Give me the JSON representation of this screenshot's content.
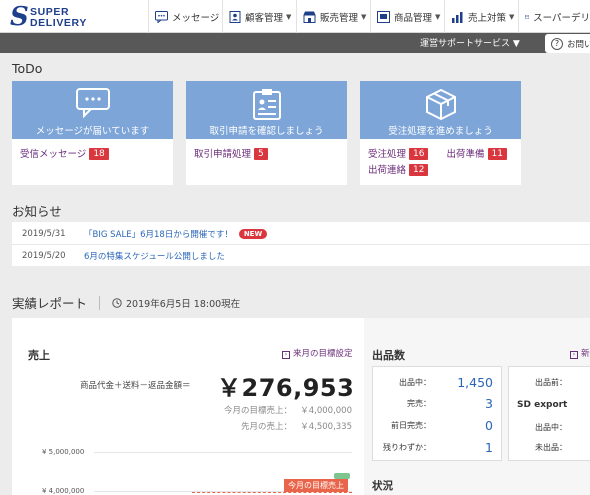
{
  "brand": {
    "mark": "S",
    "line1": "SUPER",
    "line2": "DELIVERY"
  },
  "nav": {
    "messages": "メッセージ",
    "customers": "顧客管理",
    "sales": "販売管理",
    "products": "商品管理",
    "promotion": "売上対策",
    "superdeli": "スーパーデリ"
  },
  "subbar": {
    "support": "運営サポートサービス ▼",
    "help": "お問い"
  },
  "todo": {
    "title": "ToDo",
    "cards": [
      {
        "title": "メッセージが届いています",
        "items": [
          {
            "label": "受信メッセージ",
            "count": "18"
          }
        ]
      },
      {
        "title": "取引申請を確認しましょう",
        "items": [
          {
            "label": "取引申請処理",
            "count": "5"
          }
        ]
      },
      {
        "title": "受注処理を進めましょう",
        "items": [
          {
            "label": "受注処理",
            "count": "16"
          },
          {
            "label": "出荷準備",
            "count": "11"
          },
          {
            "label": "出荷連絡",
            "count": "12"
          }
        ]
      }
    ]
  },
  "news": {
    "title": "お知らせ",
    "items": [
      {
        "date": "2019/5/31",
        "text": "「BIG SALE」6月18日から開催です！",
        "badge": "NEW"
      },
      {
        "date": "2019/5/20",
        "text": "6月の特集スケジュール公開しました"
      }
    ]
  },
  "report": {
    "title": "実績レポート",
    "timestamp": "2019年6月5日 18:00現在",
    "sales": {
      "title": "売上",
      "next_goal": "来月の目標設定",
      "formula": "商品代金＋送料－返品金額＝",
      "amount": "￥276,953",
      "goal_label": "今月の目標売上：",
      "goal_value": "￥4,000,000",
      "prev_label": "先月の売上：",
      "prev_value": "￥4,500,335",
      "axis": [
        "¥ 5,000,000",
        "¥ 4,000,000"
      ],
      "target_tag": "今月の目標売上"
    },
    "exhibits": {
      "title": "出品数",
      "new_label": "新規",
      "stats": [
        {
          "label": "出品中：",
          "value": "1,450"
        },
        {
          "label": "完売：",
          "value": "3"
        },
        {
          "label": "前日完売：",
          "value": "0"
        },
        {
          "label": "残りわずか：",
          "value": "1"
        }
      ],
      "right_before": "出品前：",
      "sd_export": "SD export",
      "right_exhibiting": "出品中：",
      "right_unlisted": "未出品："
    },
    "status_title": "状況"
  },
  "colors": {
    "card_blue": "#7da5d8",
    "badge_red": "#d9363e",
    "link_purple": "#6a2d7a",
    "link_blue": "#2a66b8"
  }
}
